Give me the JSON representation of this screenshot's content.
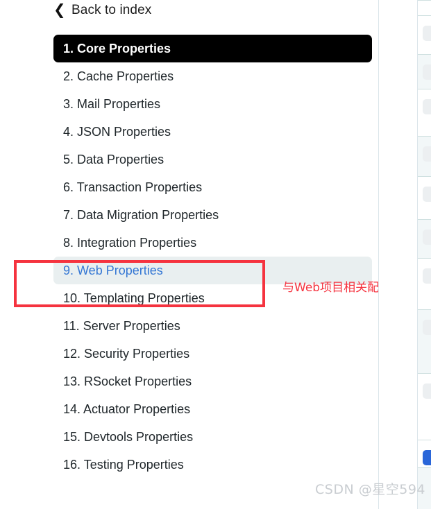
{
  "back_link": {
    "label": "Back to index",
    "icon": "chevron-left-icon"
  },
  "toc": {
    "items": [
      {
        "label": "1. Core Properties",
        "state": "active"
      },
      {
        "label": "2. Cache Properties",
        "state": "normal"
      },
      {
        "label": "3. Mail Properties",
        "state": "normal"
      },
      {
        "label": "4. JSON Properties",
        "state": "normal"
      },
      {
        "label": "5. Data Properties",
        "state": "normal"
      },
      {
        "label": "6. Transaction Properties",
        "state": "normal"
      },
      {
        "label": "7. Data Migration Properties",
        "state": "normal"
      },
      {
        "label": "8. Integration Properties",
        "state": "normal"
      },
      {
        "label": "9. Web Properties",
        "state": "current"
      },
      {
        "label": "10. Templating Properties",
        "state": "normal"
      },
      {
        "label": "11. Server Properties",
        "state": "normal"
      },
      {
        "label": "12. Security Properties",
        "state": "normal"
      },
      {
        "label": "13. RSocket Properties",
        "state": "normal"
      },
      {
        "label": "14. Actuator Properties",
        "state": "normal"
      },
      {
        "label": "15. Devtools Properties",
        "state": "normal"
      },
      {
        "label": "16. Testing Properties",
        "state": "normal"
      }
    ]
  },
  "annotation": {
    "note": "与Web项目相关配",
    "box_color": "#f5333f",
    "note_color": "#f5333f"
  },
  "watermark": {
    "text": "CSDN @星空594"
  },
  "right_panel": {
    "rows": [
      {
        "tint": "plain",
        "height": 22,
        "chip": "none"
      },
      {
        "tint": "plain",
        "height": 56,
        "chip": "block"
      },
      {
        "tint": "alt",
        "height": 50,
        "chip": "block"
      },
      {
        "tint": "plain",
        "height": 68,
        "chip": "block"
      },
      {
        "tint": "alt",
        "height": 58,
        "chip": "block"
      },
      {
        "tint": "plain",
        "height": 62,
        "chip": "block"
      },
      {
        "tint": "alt",
        "height": 56,
        "chip": "block"
      },
      {
        "tint": "plain",
        "height": 74,
        "chip": "block"
      },
      {
        "tint": "alt",
        "height": 92,
        "chip": "block"
      },
      {
        "tint": "plain",
        "height": 96,
        "chip": "block"
      },
      {
        "tint": "plain",
        "height": 40,
        "chip": "link"
      },
      {
        "tint": "alt",
        "height": 60,
        "chip": "none"
      }
    ]
  },
  "colors": {
    "active_background": "#000000",
    "active_text": "#ffffff",
    "current_background": "#e9eff0",
    "current_text": "#3477d4",
    "body_text": "#20272b",
    "rule": "#dbe5ea"
  }
}
